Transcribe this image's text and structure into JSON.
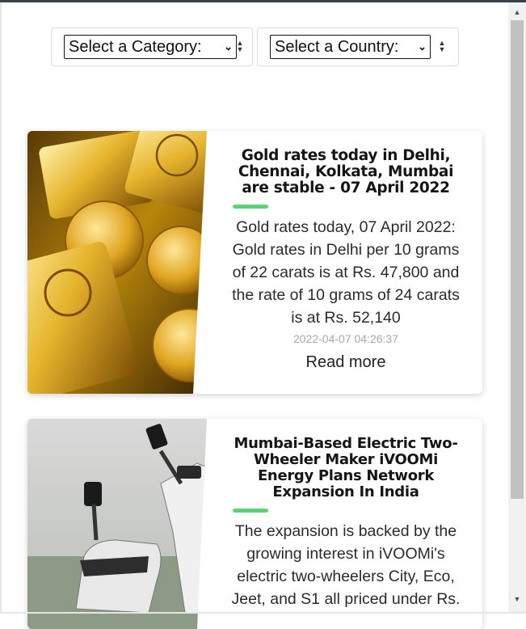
{
  "filters": {
    "category_value": "Select a Category:",
    "country_value": "Select a Country:"
  },
  "articles": [
    {
      "title": "Gold rates today in Delhi, Chennai, Kolkata, Mumbai are stable - 07 April 2022",
      "description": "Gold rates today, 07 April 2022: Gold rates in Delhi per 10 grams of 22 carats is at Rs. 47,800 and the rate of 10 grams of 24 carats is at Rs. 52,140",
      "date": "2022-04-07 04:26:37",
      "read_more": "Read more",
      "image_alt": "gold bars and coins"
    },
    {
      "title": "Mumbai-Based Electric Two-Wheeler Maker iVOOMi Energy Plans Network Expansion In India",
      "description": "The expansion is backed by the growing interest in iVOOMi's electric two-wheelers City, Eco, Jeet, and S1 all priced under Rs.",
      "image_alt": "electric scooters"
    }
  ],
  "colors": {
    "accent": "#5fd07a",
    "scrollbar_thumb": "#c1c1c1",
    "scrollbar_track": "#f1f1f1"
  },
  "icons": {
    "dropdown": "chevron-down-icon",
    "sort": "sort-arrows-icon",
    "scroll_up": "scroll-up-arrow-icon",
    "scroll_down": "scroll-down-arrow-icon"
  }
}
